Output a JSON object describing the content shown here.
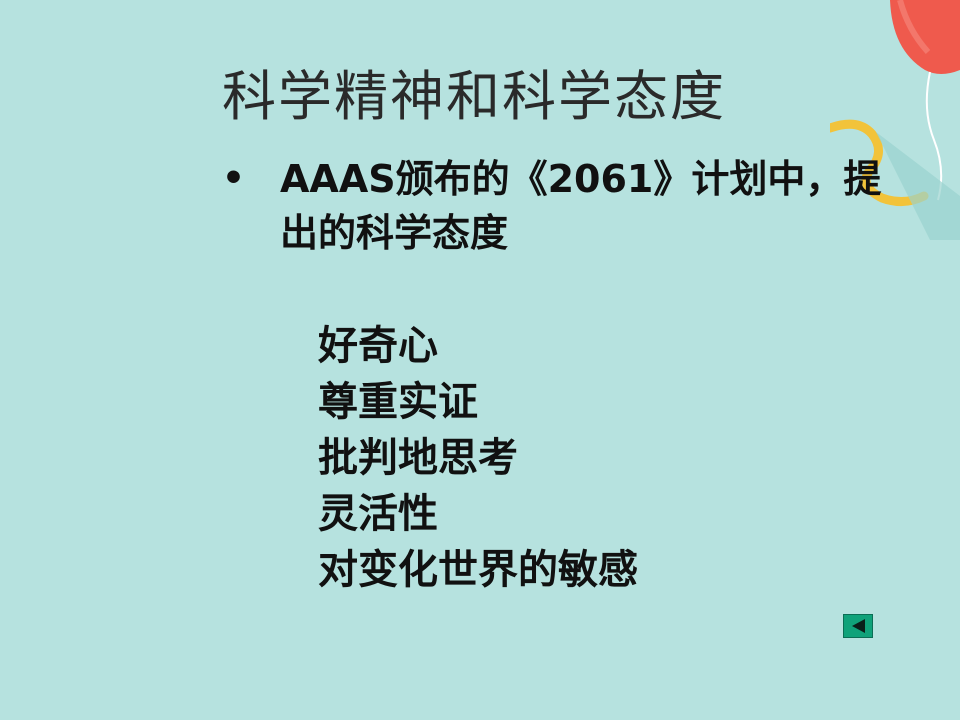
{
  "slide": {
    "title": "科学精神和科学态度",
    "bullet": {
      "marker": "•",
      "text": "AAAS颁布的《2061》计划中，提出的科学态度"
    },
    "attitudes": [
      "好奇心",
      "尊重实证",
      "批判地思考",
      "灵活性",
      "对变化世界的敏感"
    ],
    "nav": {
      "icon": "triangle-left-icon",
      "color": "#10a27a"
    }
  },
  "colors": {
    "background": "#b6e2df",
    "balloon": "#ef5a4d",
    "ribbon": "#f2c33a"
  }
}
